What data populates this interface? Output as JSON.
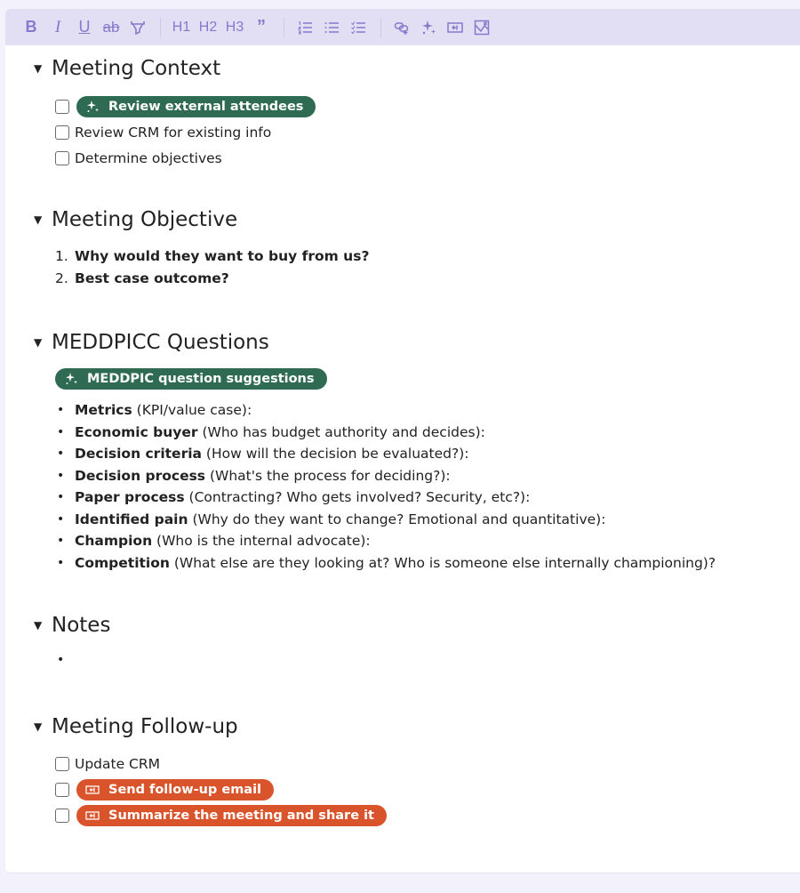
{
  "toolbar": {
    "bold": "B",
    "italic": "I",
    "underline": "U",
    "strike": "ab",
    "h1": "H1",
    "h2": "H2",
    "h3": "H3",
    "quote": "”",
    "icons": [
      "bold-icon",
      "italic-icon",
      "underline-icon",
      "strikethrough-icon",
      "highlighter-icon",
      "h1-icon",
      "h2-icon",
      "h3-icon",
      "quote-icon",
      "numbered-list-icon",
      "bullet-list-icon",
      "checklist-icon",
      "link-icon",
      "sparkle-icon",
      "insert-action-icon",
      "image-icon"
    ]
  },
  "colors": {
    "toolbar_bg": "#e2dff5",
    "toolbar_icon": "#8679cc",
    "ai_pill": "#2e6b52",
    "action_pill": "#d9542b",
    "page_bg": "#f3f1fc"
  },
  "sections": {
    "context": {
      "title": "Meeting Context",
      "tasks": [
        {
          "label": "Review external attendees",
          "type": "ai-pill",
          "checked": false
        },
        {
          "label": "Review CRM for existing info",
          "type": "text",
          "checked": false
        },
        {
          "label": "Determine objectives",
          "type": "text",
          "checked": false
        }
      ]
    },
    "objective": {
      "title": "Meeting Objective",
      "items": [
        {
          "num": "1.",
          "text": "Why would they want to buy from us?"
        },
        {
          "num": "2.",
          "text": "Best case outcome?"
        }
      ]
    },
    "meddpicc": {
      "title": "MEDDPICC Questions",
      "pill": "MEDDPIC question suggestions",
      "items": [
        {
          "term": "Metrics",
          "desc": " (KPI/value case):"
        },
        {
          "term": "Economic buyer",
          "desc": " (Who has budget authority and decides):"
        },
        {
          "term": "Decision criteria",
          "desc": " (How will the decision be evaluated?):"
        },
        {
          "term": "Decision process",
          "desc": " (What's the process for deciding?):"
        },
        {
          "term": "Paper process",
          "desc": " (Contracting? Who gets involved? Security, etc?):"
        },
        {
          "term": "Identified pain",
          "desc": " (Why do they want to change? Emotional and quantitative):"
        },
        {
          "term": "Champion",
          "desc": " (Who is the internal advocate):"
        },
        {
          "term": "Competition",
          "desc": " (What else are they looking at? Who is someone else internally championing)?"
        }
      ]
    },
    "notes": {
      "title": "Notes",
      "bullet": "•"
    },
    "followup": {
      "title": "Meeting Follow-up",
      "tasks": [
        {
          "label": "Update CRM",
          "type": "text",
          "checked": false
        },
        {
          "label": "Send follow-up email",
          "type": "action-pill",
          "checked": false
        },
        {
          "label": "Summarize the meeting and share it",
          "type": "action-pill",
          "checked": false
        }
      ]
    }
  },
  "caret": "▼",
  "bullet": "•"
}
